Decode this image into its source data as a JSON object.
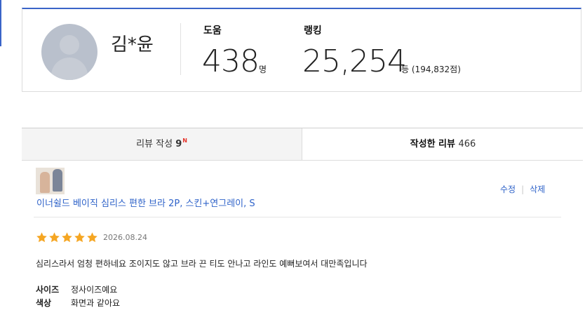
{
  "profile": {
    "name": "김*윤",
    "help": {
      "label": "도움",
      "value": "438",
      "unit": "명"
    },
    "ranking": {
      "label": "랭킹",
      "value": "25,254",
      "unit": "등",
      "total": "(194,832점)"
    }
  },
  "tabs": {
    "write": {
      "label": "리뷰 작성",
      "count": "9",
      "badge": "N"
    },
    "written": {
      "label": "작성한 리뷰",
      "count": "466"
    }
  },
  "review": {
    "product_name": "이너쉴드 베이직 심리스 편한 브라 2P, 스킨+연그레이, S",
    "edit_label": "수정",
    "delete_label": "삭제",
    "separator": "|",
    "rating": 5,
    "date": "2026.08.24",
    "text": "심리스라서 엄청 편하네요 조이지도 않고 브라 끈 티도 안나고 라인도 예뻐보여서 대만족입니다",
    "options": [
      {
        "label": "사이즈",
        "value": "정사이즈예요"
      },
      {
        "label": "색상",
        "value": "화면과 같아요"
      }
    ]
  },
  "colors": {
    "accent": "#3a64c8",
    "link": "#2f63c9",
    "star": "#f5a623",
    "badge": "#e5332a"
  }
}
